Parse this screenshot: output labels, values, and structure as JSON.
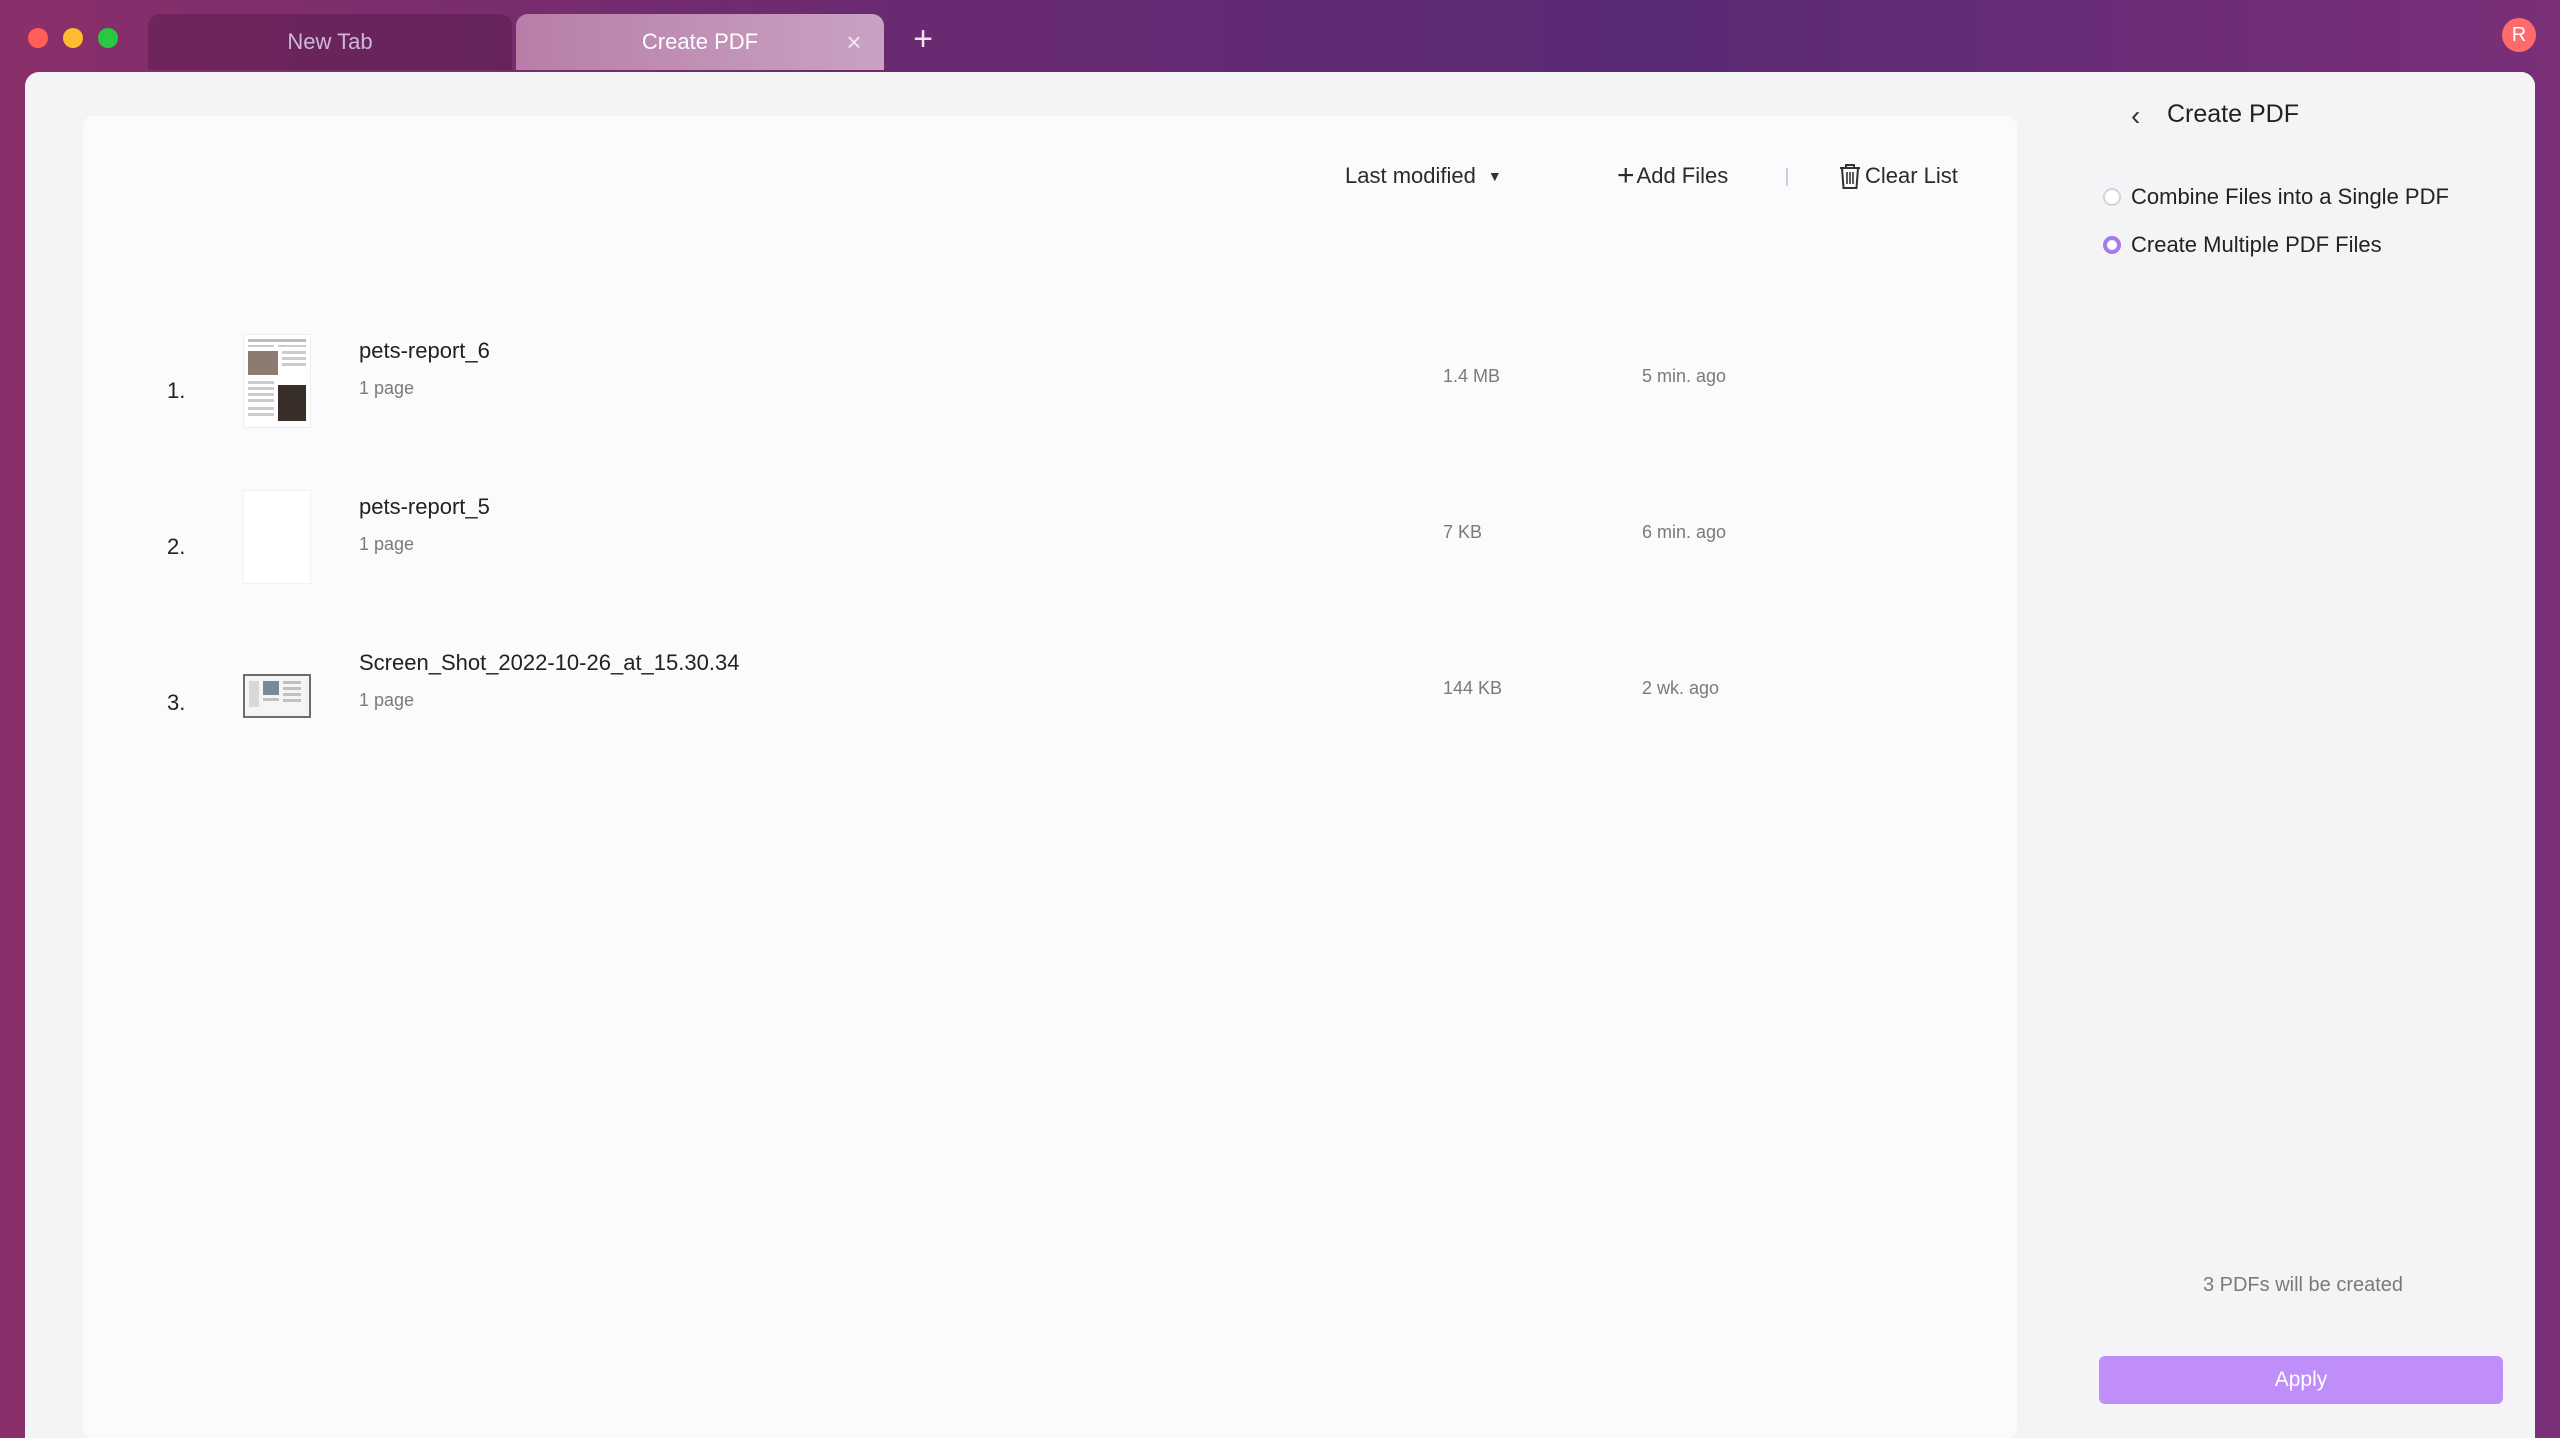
{
  "tabs": [
    {
      "label": "New Tab"
    },
    {
      "label": "Create PDF"
    }
  ],
  "avatar": {
    "initial": "R"
  },
  "toolbar": {
    "sort_label": "Last modified",
    "add_files_label": "Add Files",
    "clear_list_label": "Clear List"
  },
  "files": [
    {
      "index": "1.",
      "name": "pets-report_6",
      "pages": "1 page",
      "size": "1.4 MB",
      "modified": "5 min. ago"
    },
    {
      "index": "2.",
      "name": "pets-report_5",
      "pages": "1 page",
      "size": "7 KB",
      "modified": "6 min. ago"
    },
    {
      "index": "3.",
      "name": "Screen_Shot_2022-10-26_at_15.30.34",
      "pages": "1 page",
      "size": "144 KB",
      "modified": "2 wk. ago"
    }
  ],
  "panel": {
    "title": "Create PDF",
    "options": [
      {
        "label": "Combine Files into a Single PDF",
        "selected": false
      },
      {
        "label": "Create Multiple PDF Files",
        "selected": true
      }
    ],
    "note": "3 PDFs will be created",
    "apply_label": "Apply"
  },
  "colors": {
    "accent": "#bf8ef8",
    "radio_selected": "#a67ae8"
  }
}
